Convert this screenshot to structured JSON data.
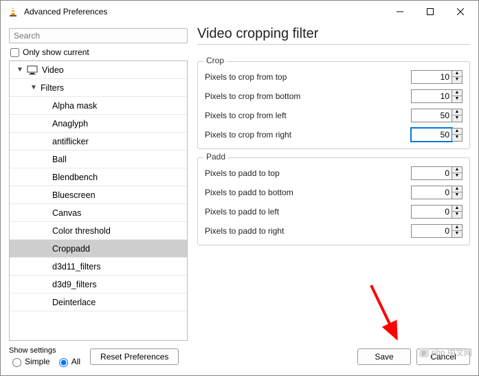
{
  "window": {
    "title": "Advanced Preferences"
  },
  "search": {
    "placeholder": "Search"
  },
  "only_show_current": {
    "label": "Only show current"
  },
  "tree": {
    "root": {
      "label": "Video"
    },
    "filters_label": "Filters",
    "items": [
      "Alpha mask",
      "Anaglyph",
      "antiflicker",
      "Ball",
      "Blendbench",
      "Bluescreen",
      "Canvas",
      "Color threshold",
      "Croppadd",
      "d3d11_filters",
      "d3d9_filters",
      "Deinterlace"
    ],
    "selected": "Croppadd"
  },
  "panel": {
    "title": "Video cropping filter",
    "crop": {
      "legend": "Crop",
      "rows": [
        {
          "label": "Pixels to crop from top",
          "value": "10"
        },
        {
          "label": "Pixels to crop from bottom",
          "value": "10"
        },
        {
          "label": "Pixels to crop from left",
          "value": "50"
        },
        {
          "label": "Pixels to crop from right",
          "value": "50"
        }
      ],
      "focused_index": 3
    },
    "padd": {
      "legend": "Padd",
      "rows": [
        {
          "label": "Pixels to padd to top",
          "value": "0"
        },
        {
          "label": "Pixels to padd to bottom",
          "value": "0"
        },
        {
          "label": "Pixels to padd to left",
          "value": "0"
        },
        {
          "label": "Pixels to padd to right",
          "value": "0"
        }
      ]
    }
  },
  "footer": {
    "show_settings": "Show settings",
    "simple": "Simple",
    "all": "All",
    "reset": "Reset Preferences",
    "save": "Save",
    "cancel": "Cancel"
  },
  "watermark": "php 中文网"
}
